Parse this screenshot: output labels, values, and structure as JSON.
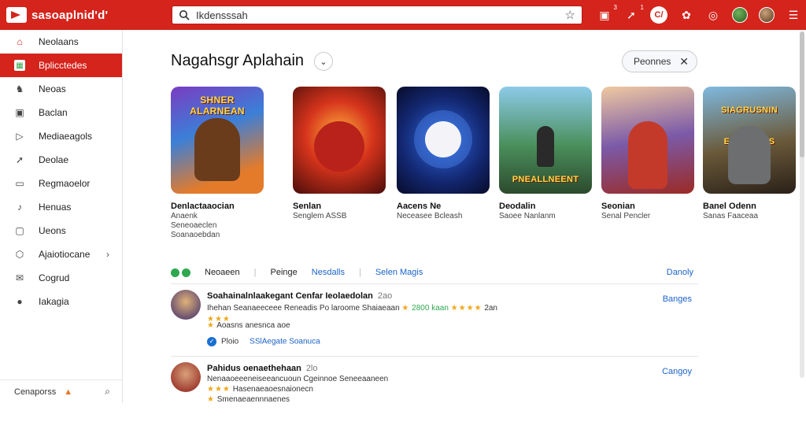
{
  "app": {
    "logo_text": "sasoaplnid'd'"
  },
  "search": {
    "value": "Ikdensssah"
  },
  "topbar": {
    "actions": [
      {
        "icon": "notification-icon",
        "badge": "3"
      },
      {
        "icon": "share-icon",
        "badge": "1"
      },
      {
        "icon": "account-circle-icon",
        "label": "C/"
      },
      {
        "icon": "settings-icon"
      },
      {
        "icon": "help-icon"
      }
    ]
  },
  "sidebar": {
    "items": [
      {
        "label": "Neolaans",
        "icon": "home-icon",
        "glyph": "⌂"
      },
      {
        "label": "Bplicctedes",
        "icon": "apps-icon",
        "glyph": "▦"
      },
      {
        "label": "Neoas",
        "icon": "games-icon",
        "glyph": "♞"
      },
      {
        "label": "Baclan",
        "icon": "movies-icon",
        "glyph": "▣"
      },
      {
        "label": "Mediaeagols",
        "icon": "books-icon",
        "glyph": "▷"
      },
      {
        "label": "Deolae",
        "icon": "trending-icon",
        "glyph": "➚"
      },
      {
        "label": "Regmaoelor",
        "icon": "library-icon",
        "glyph": "▭"
      },
      {
        "label": "Henuas",
        "icon": "music-icon",
        "glyph": "♪"
      },
      {
        "label": "Ueons",
        "icon": "tv-icon",
        "glyph": "▢"
      },
      {
        "label": "Ajaiotiocane",
        "icon": "category-icon",
        "glyph": "⬡",
        "chevron": "›"
      },
      {
        "label": "Cogrud",
        "icon": "mail-icon",
        "glyph": "✉"
      },
      {
        "label": "Iakagia",
        "icon": "account-icon",
        "glyph": "●"
      }
    ],
    "footer": {
      "label": "Cenaporss"
    }
  },
  "main": {
    "title": "Nagahsgr Aplahain",
    "filter_chip": "Peonnes",
    "cards": [
      {
        "banner": "SHNER ALARNEAN",
        "title": "Denlactaaocian",
        "sub": [
          "Anaenk",
          "Seneoaeclen",
          "Soanaoebdan"
        ]
      },
      {
        "banner": "",
        "title": "Senlan",
        "sub": [
          "Senglem",
          "ASSB"
        ]
      },
      {
        "banner": "",
        "title": "Aacens Ne",
        "sub": [
          "Neceasee",
          "Bcleash"
        ]
      },
      {
        "banner": "PNEALLNEENT",
        "title": "Deodalin",
        "sub": [
          "Saoee",
          "Nanlanm"
        ]
      },
      {
        "banner": "",
        "title": "Seonian",
        "sub": [
          "Senal Pencler"
        ]
      },
      {
        "banner": "SIAGRUSNIN EAUGSRNS",
        "title": "Banel Odenn",
        "sub": [
          "Sanas Faaceaa"
        ]
      }
    ],
    "tabs": {
      "items": [
        "Neoaeen",
        "Peinge"
      ],
      "links": [
        "Nesdalls",
        "Selen Magis"
      ],
      "right": "Danoly"
    },
    "reviews": [
      {
        "title": "Soahainalnlaakegant Cenfar Ieolaedolan",
        "count": "2ao",
        "line1": "Ihehan  Seanaeeceee Reneadis Po laroome  Shaiaeaan",
        "rating_a": "2800 kaan",
        "rating_b": "2an",
        "line2_stars": "★★★",
        "line3": "Aoasns anesnca aoe",
        "tag_label": "Ploio",
        "tag_link": "SSlAegate Soanuca",
        "action": "Banges"
      },
      {
        "title": "Pahidus oenaethehaan",
        "count": "2lo",
        "line1": "Nenaaoeeeneiseeancuoun Cgeinnoe Seneeaaneen",
        "line2": "Hasenaeaoesnaionecn",
        "line3": "Smenaeaennnaenes",
        "action": "Cangoy"
      }
    ]
  }
}
